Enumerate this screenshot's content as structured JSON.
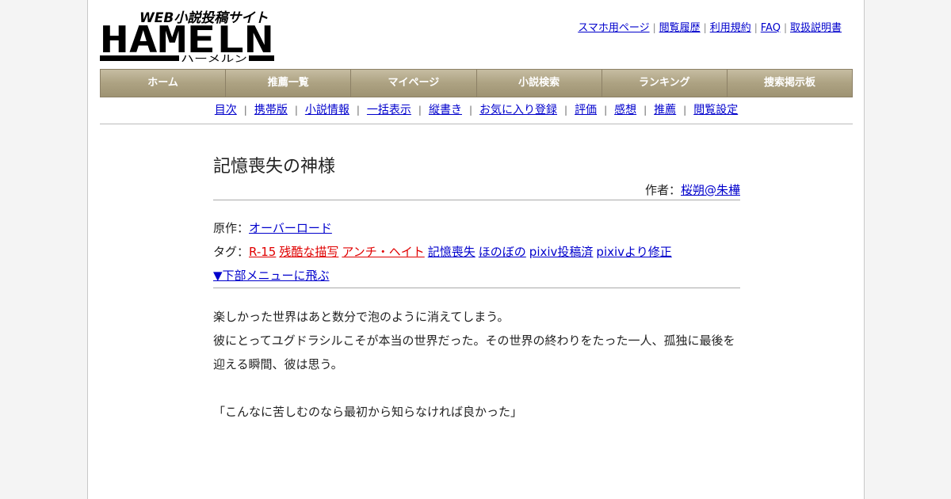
{
  "logo": {
    "tagline": "WEB小説投稿サイト",
    "name": "HAMELN",
    "kana": "ハーメルン"
  },
  "toplinks": [
    "スマホ用ページ",
    "閲覧履歴",
    "利用規約",
    "FAQ",
    "取扱説明書"
  ],
  "mainnav": [
    "ホーム",
    "推薦一覧",
    "マイページ",
    "小説検索",
    "ランキング",
    "捜索掲示板"
  ],
  "subnav": [
    "目次",
    "携帯版",
    "小説情報",
    "一括表示",
    "縦書き",
    "お気に入り登録",
    "評価",
    "感想",
    "推薦",
    "閲覧設定"
  ],
  "novel": {
    "title": "記憶喪失の神様",
    "author_label": "作者：",
    "author_name": "桜朔@朱樺",
    "original_label": "原作：",
    "original_name": "オーバーロード",
    "tags_label": "タグ：",
    "tags": [
      {
        "text": "R-15",
        "warning": true
      },
      {
        "text": "残酷な描写",
        "warning": true
      },
      {
        "text": "アンチ・ヘイト",
        "warning": true
      },
      {
        "text": "記憶喪失",
        "warning": false
      },
      {
        "text": "ほのぼの",
        "warning": false
      },
      {
        "text": "pixiv投稿済",
        "warning": false
      },
      {
        "text": "pixivより修正",
        "warning": false
      }
    ],
    "jump_link": "▼下部メニューに飛ぶ"
  },
  "body": {
    "line1": "楽しかった世界はあと数分で泡のように消えてしまう。",
    "line2": "彼にとってユグドラシルこそが本当の世界だった。その世界の終わりをたった一人、孤独に最後を",
    "line3": "迎える瞬間、彼は思う。",
    "line4": "「こんなに苦しむのなら最初から知らなければ良かった」"
  },
  "colors": {
    "link": "#0000cc",
    "warning_tag": "#e00000",
    "nav_bg": "#ada282"
  }
}
